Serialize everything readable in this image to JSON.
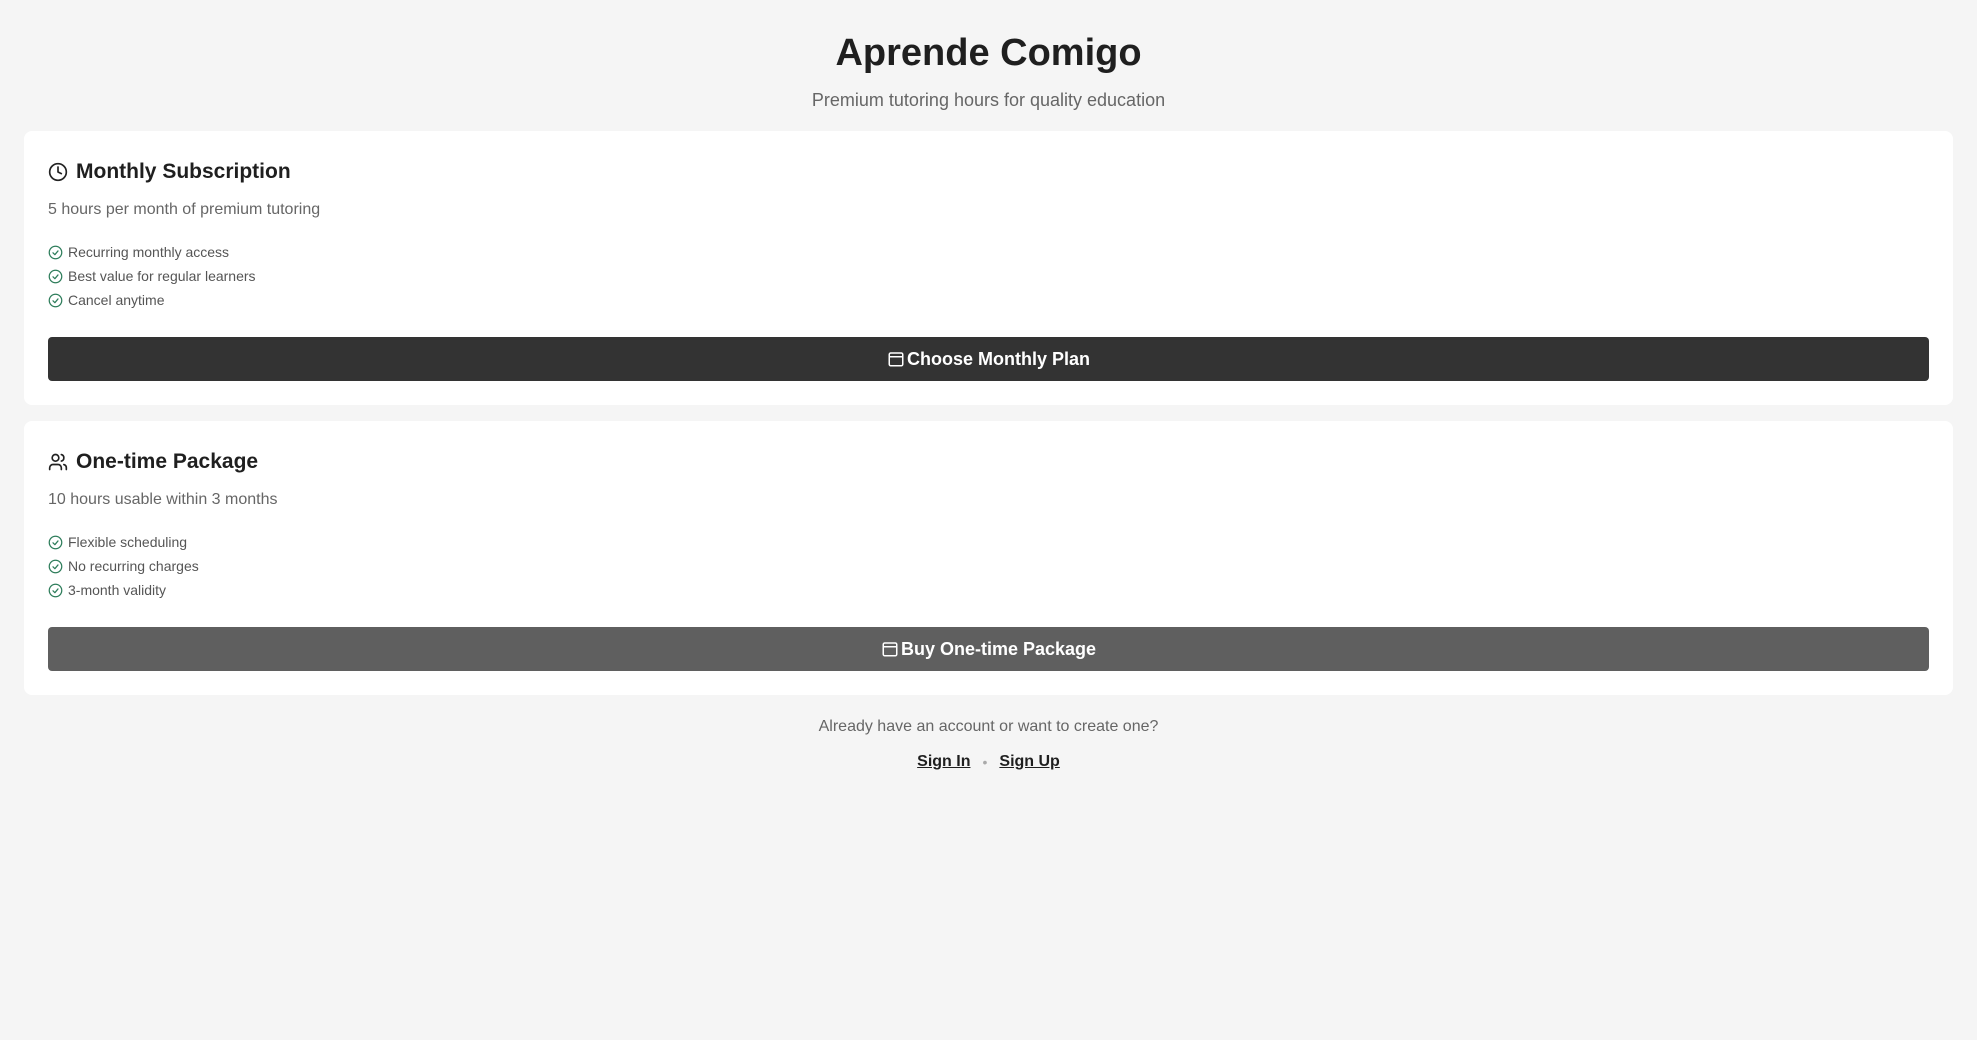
{
  "header": {
    "title": "Aprende Comigo",
    "subtitle": "Premium tutoring hours for quality education"
  },
  "plans": [
    {
      "icon": "clock-icon",
      "title": "Monthly Subscription",
      "description": "5 hours per month of premium tutoring",
      "features": [
        "Recurring monthly access",
        "Best value for regular learners",
        "Cancel anytime"
      ],
      "button_icon": "calendar-icon",
      "button_label": "Choose Monthly Plan",
      "button_color": "#333333"
    },
    {
      "icon": "users-icon",
      "title": "One-time Package",
      "description": "10 hours usable within 3 months",
      "features": [
        "Flexible scheduling",
        "No recurring charges",
        "3-month validity"
      ],
      "button_icon": "calendar-icon",
      "button_label": "Buy One-time Package",
      "button_color": "#5f5f5f"
    }
  ],
  "footer": {
    "prompt": "Already have an account or want to create one?",
    "sign_in": "Sign In",
    "separator": "•",
    "sign_up": "Sign Up"
  },
  "colors": {
    "background": "#f5f5f5",
    "card": "#ffffff",
    "check": "#2e7d5b",
    "text_muted": "#666666"
  }
}
